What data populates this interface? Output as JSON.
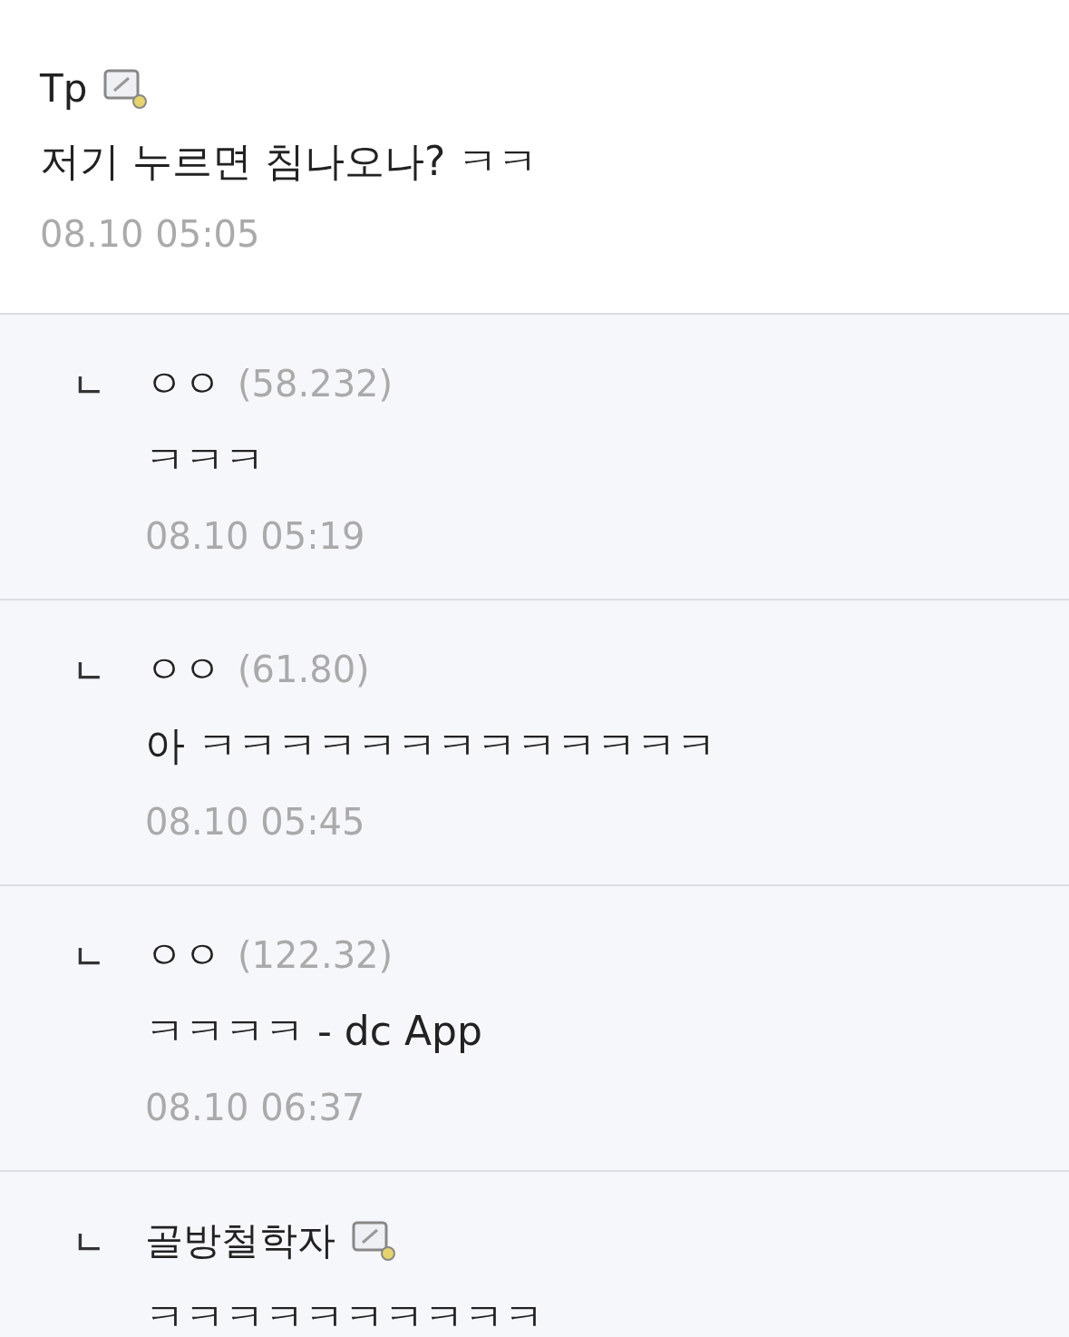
{
  "comment": {
    "author": "Tp",
    "member_badge": true,
    "text": "저기 누르면 침나오나? ㅋㅋ",
    "date": "08.10 05:05"
  },
  "replies": [
    {
      "marker": "ㄴ",
      "author": "ㅇㅇ",
      "member_badge": false,
      "ip": "(58.232)",
      "text": "ㅋㅋㅋ",
      "date": "08.10 05:19"
    },
    {
      "marker": "ㄴ",
      "author": "ㅇㅇ",
      "member_badge": false,
      "ip": "(61.80)",
      "text": "아 ㅋㅋㅋㅋㅋㅋㅋㅋㅋㅋㅋㅋㅋ",
      "date": "08.10 05:45"
    },
    {
      "marker": "ㄴ",
      "author": "ㅇㅇ",
      "member_badge": false,
      "ip": "(122.32)",
      "text": "ㅋㅋㅋㅋ - dc App",
      "date": "08.10 06:37"
    },
    {
      "marker": "ㄴ",
      "author": "골방철학자",
      "member_badge": true,
      "text": "ㅋㅋㅋㅋㅋㅋㅋㅋㅋㅋ"
    }
  ]
}
